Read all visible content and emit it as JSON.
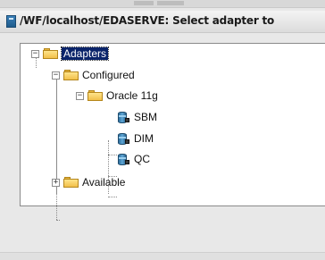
{
  "window": {
    "title": "/WF/localhost/EDASERVE: Select adapter to"
  },
  "tree": {
    "root": {
      "label": "Adapters",
      "expander": "−",
      "children": {
        "configured": {
          "label": "Configured",
          "expander": "−",
          "oracle": {
            "label": "Oracle 11g",
            "expander": "−",
            "items": [
              "SBM",
              "DIM",
              "QC"
            ]
          }
        },
        "available": {
          "label": "Available",
          "expander": "+"
        }
      }
    }
  },
  "colors": {
    "selection": "#0a246a",
    "folder": "#f1c04a",
    "database": "#2f6f9e"
  },
  "icons": {
    "window": "application-window-icon",
    "folder": "folder-icon",
    "adapter": "database-adapter-icon"
  }
}
